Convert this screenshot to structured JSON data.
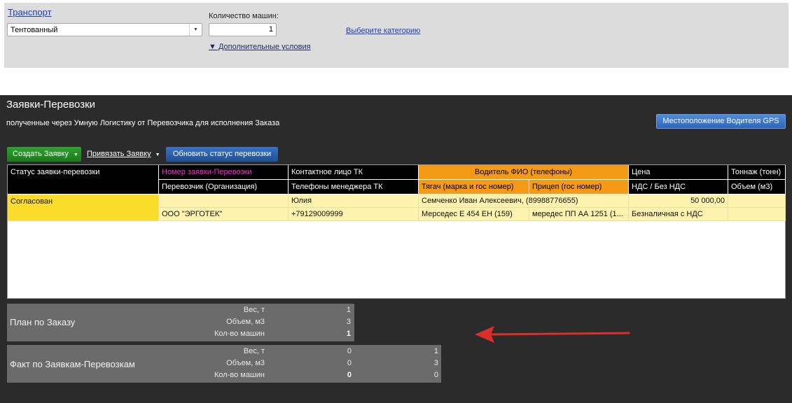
{
  "filter": {
    "transport_link": "Транспорт",
    "transport_value": "Тентованный",
    "machines_label": "Количество машин:",
    "machines_value": "1",
    "category_link": "Выберите категорию",
    "extra_conditions": "▼ Дополнительные условия"
  },
  "section": {
    "title": "Заявки-Перевозки",
    "subtitle": "полученные через Умную Логистику от Перевозчика для исполнения Заказа",
    "gps_button": "Местоположение Водителя GPS",
    "create_button": "Создать Заявку",
    "link_button": "Привязать Заявку",
    "refresh_button": "Обновить статус перевозки"
  },
  "table": {
    "header_row1": [
      "Статус заявки-перевозки",
      "Номер заявки-Перевозки",
      "Контактное лицо ТК",
      "Водитель ФИО (телефоны)",
      "Цена",
      "Тоннаж (тонн)"
    ],
    "header_row2": [
      "Перевозчик (Организация)",
      "Телефоны менеджера ТК",
      "Тягач (марка и гос номер)",
      "Прицеп (гос номер)",
      "НДС / Без НДС",
      "Объем (м3)"
    ],
    "rows": [
      {
        "status": "Согласован",
        "number": "",
        "contact": "Юлия",
        "driver": "Семченко Иван Алексеевич, (89988776655)",
        "price": "50 000,00",
        "tonnage": "",
        "carrier": "ООО \"ЭРГОТЕК\"",
        "manager_phone": "+79129009999",
        "tractor": "Мерседес Е 454 ЕН (159)",
        "trailer": "мередес  ПП АА 1251 (1...",
        "vat": "Безналичная с НДС",
        "volume": ""
      }
    ]
  },
  "plan": {
    "title": "План по Заказу",
    "labels": [
      "Вес, т",
      "Объем, м3",
      "Кол-во машин"
    ],
    "values": [
      "1",
      "3",
      "1"
    ]
  },
  "fact": {
    "title": "Факт по Заявкам-Перевозкам",
    "labels": [
      "Вес, т",
      "Объем, м3",
      "Кол-во машин"
    ],
    "values_col1": [
      "0",
      "0",
      "0"
    ],
    "values_col2": [
      "1",
      "3",
      "0"
    ]
  },
  "colors": {
    "accent_orange": "#f59a17",
    "status_yellow": "#fbdc2a",
    "row_yellow": "#fdf2ae",
    "magenta_header": "#ff2bd6",
    "arrow_red": "#d9302b",
    "gps_blue": "#3a78cc",
    "create_green": "#1e8a1e"
  },
  "icons": [
    "dropdown-arrow-icon",
    "red-arrow-icon"
  ]
}
